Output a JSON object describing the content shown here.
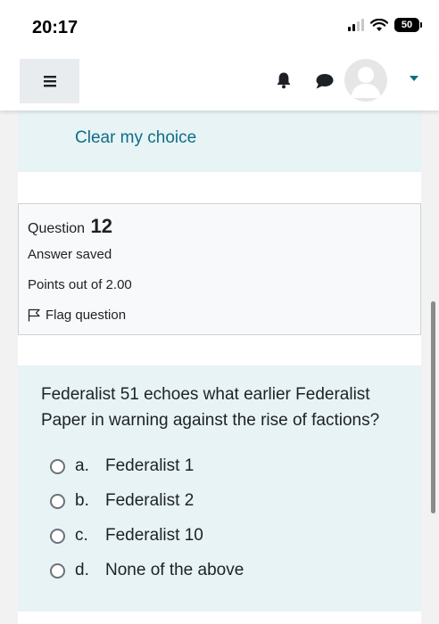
{
  "status_bar": {
    "time": "20:17",
    "battery": "50",
    "icons": [
      "signal-icon",
      "wifi-icon",
      "battery-icon"
    ]
  },
  "navbar": {
    "icons": [
      "hamburger-menu-icon",
      "bell-icon",
      "chat-icon",
      "avatar",
      "caret-down-icon"
    ],
    "accent": "#0f6e85"
  },
  "previous_question": {
    "clear_choice": "Clear my choice"
  },
  "question_info": {
    "label": "Question",
    "number": "12",
    "state": "Answer saved",
    "points": "Points out of 2.00",
    "flag": "Flag question"
  },
  "question": {
    "text": "Federalist 51 echoes what earlier Federalist Paper in warning against the rise of factions?",
    "options": [
      {
        "letter": "a.",
        "label": "Federalist 1"
      },
      {
        "letter": "b.",
        "label": "Federalist 2"
      },
      {
        "letter": "c.",
        "label": "Federalist 10"
      },
      {
        "letter": "d.",
        "label": "None of the above"
      }
    ]
  },
  "colors": {
    "card_background": "#e7f3f5",
    "info_background": "#f8f9fa",
    "link": "#0f6e85"
  }
}
